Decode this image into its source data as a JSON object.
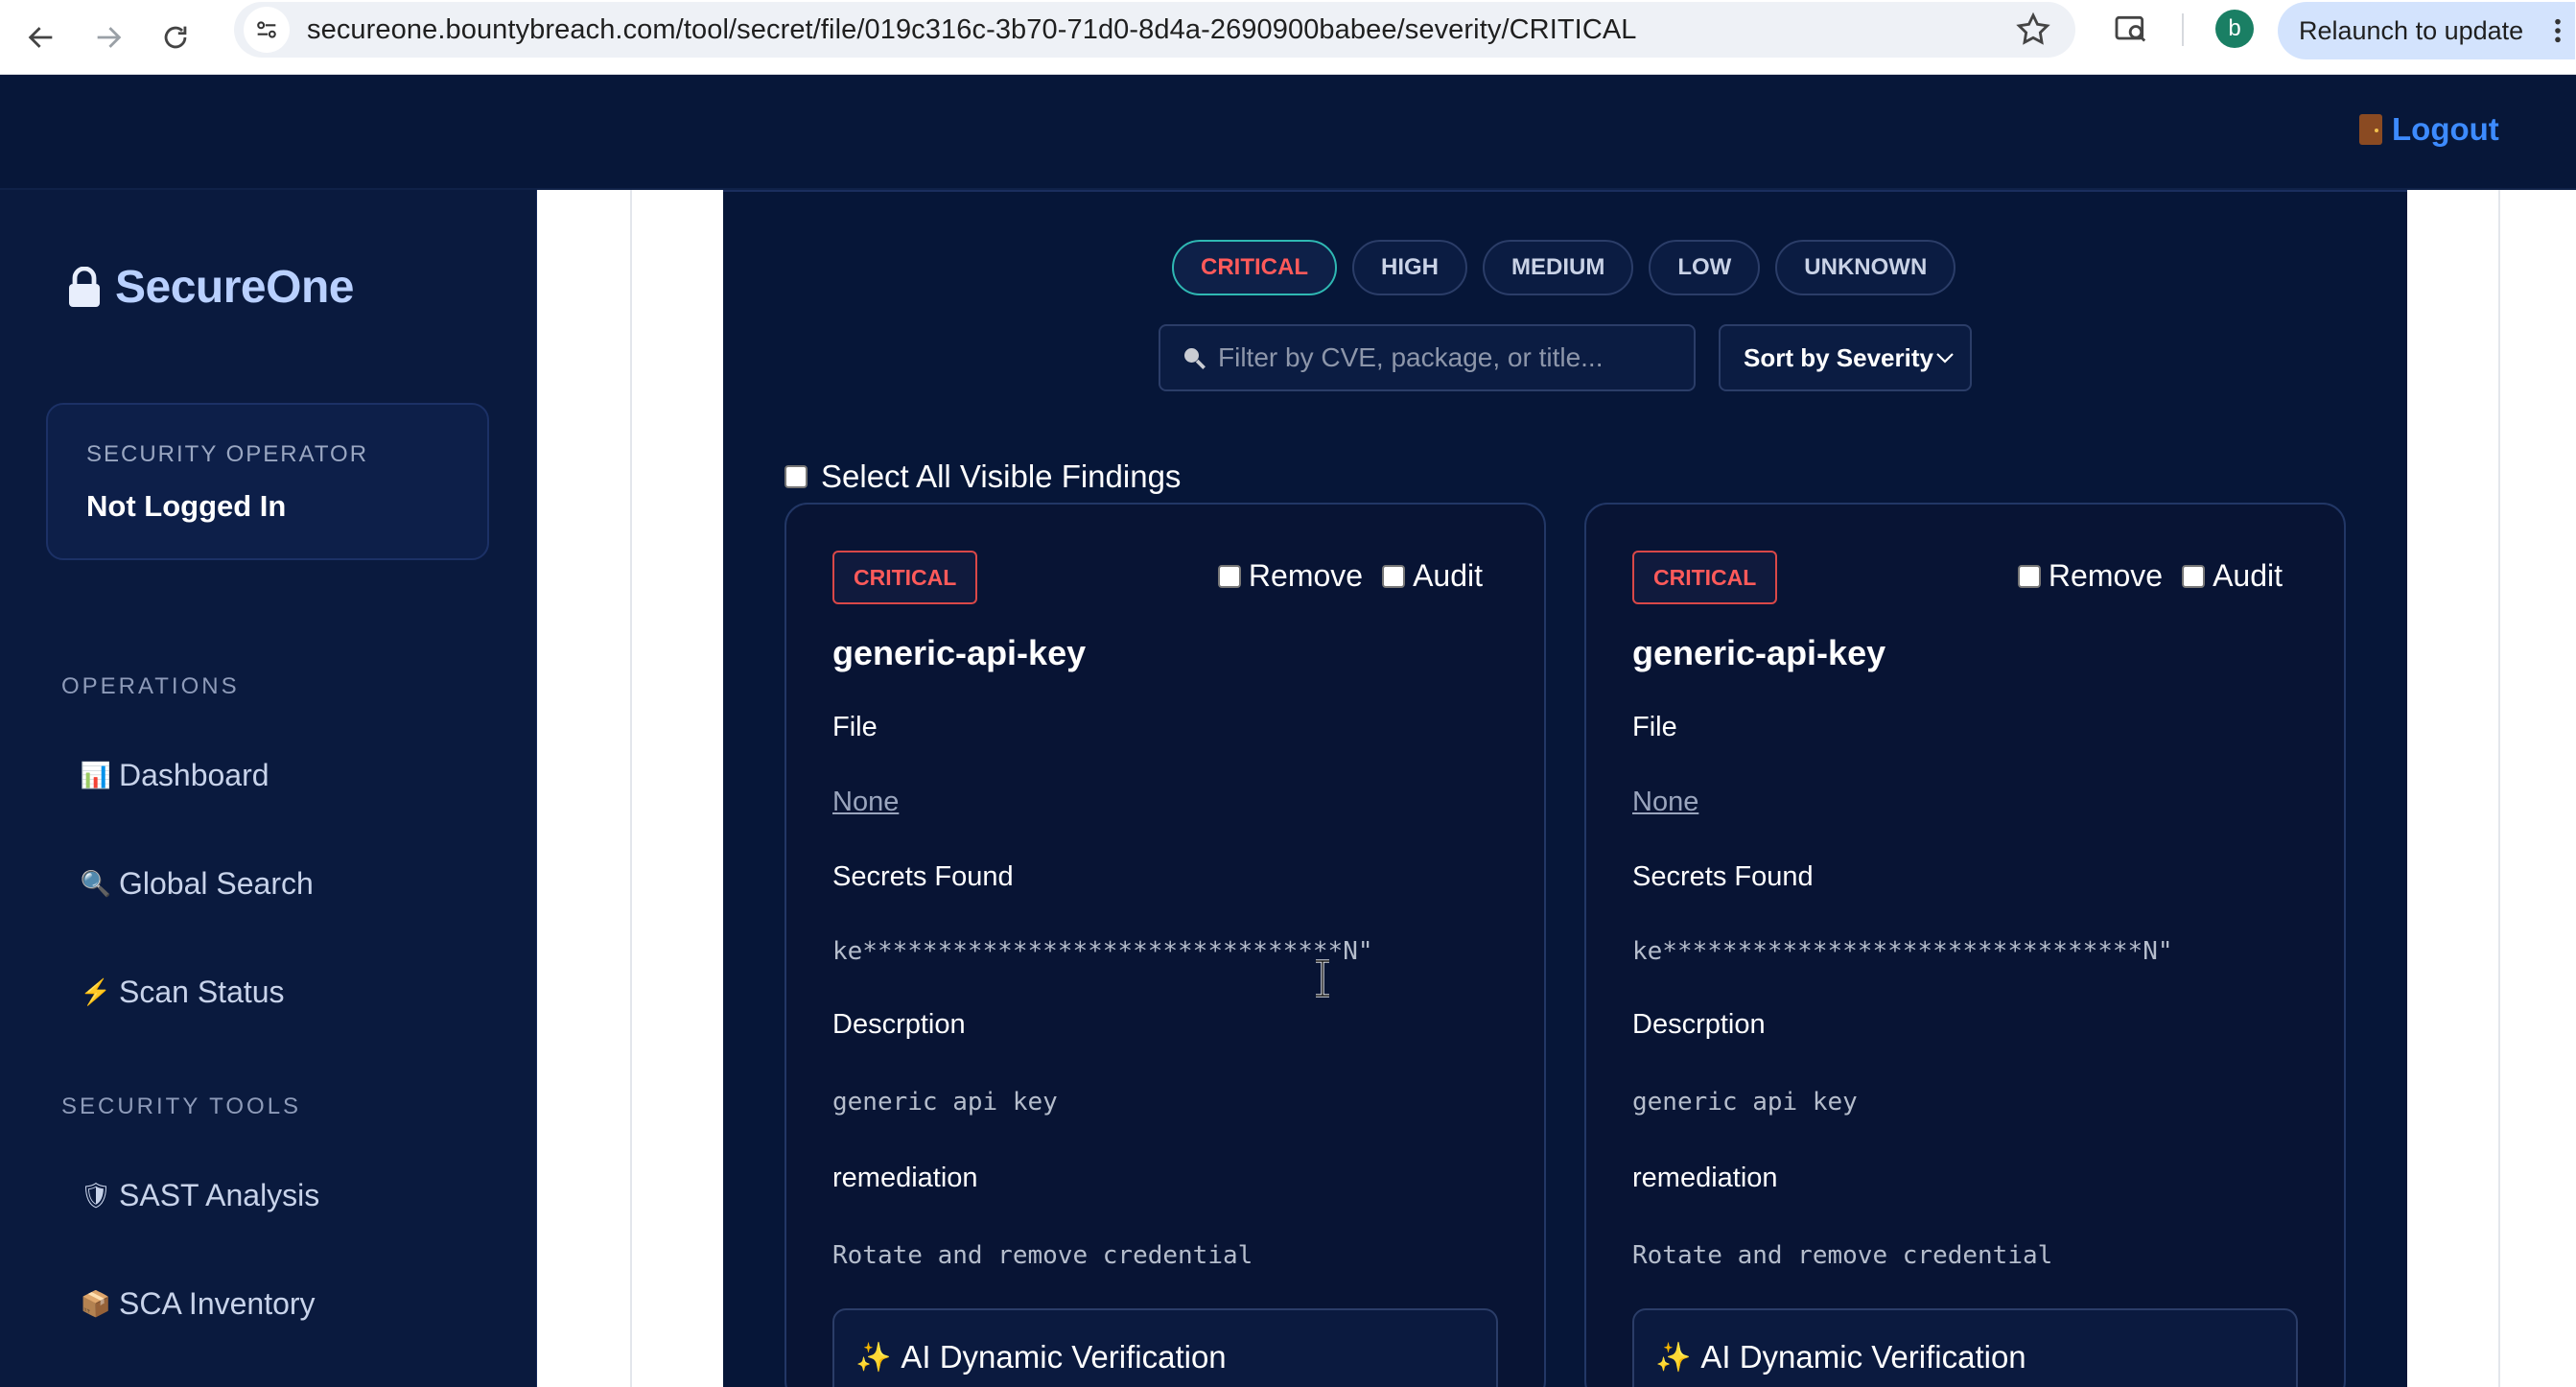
{
  "browser": {
    "url": "secureone.bountybreach.com/tool/secret/file/019c316c-3b70-71d0-8d4a-2690900babee/severity/CRITICAL",
    "profile_initial": "b",
    "relaunch_label": "Relaunch to update"
  },
  "topbar": {
    "logout_label": "Logout"
  },
  "sidebar": {
    "brand": "SecureOne",
    "operator_role": "SECURITY OPERATOR",
    "operator_status": "Not Logged In",
    "sections": [
      {
        "label": "OPERATIONS",
        "items": [
          {
            "icon": "📊",
            "label": "Dashboard"
          },
          {
            "icon": "🔍",
            "label": "Global Search"
          },
          {
            "icon": "⚡",
            "label": "Scan Status"
          }
        ]
      },
      {
        "label": "SECURITY TOOLS",
        "items": [
          {
            "icon": "🛡",
            "label": "SAST Analysis"
          },
          {
            "icon": "📦",
            "label": "SCA Inventory"
          }
        ]
      }
    ]
  },
  "filters": {
    "severity_tabs": [
      "CRITICAL",
      "HIGH",
      "MEDIUM",
      "LOW",
      "UNKNOWN"
    ],
    "active_tab": "CRITICAL",
    "search_placeholder": "Filter by CVE, package, or title...",
    "sort_label": "Sort by Severity"
  },
  "select_all_label": "Select All Visible Findings",
  "findings": [
    {
      "severity": "CRITICAL",
      "remove_label": "Remove",
      "audit_label": "Audit",
      "title": "generic-api-key",
      "file_label": "File",
      "file_value": "None",
      "secrets_label": "Secrets Found",
      "secret_value": "ke********************************N\"",
      "description_label": "Descrption",
      "description_value": "generic api key",
      "remediation_label": "remediation",
      "remediation_value": "Rotate and remove credential",
      "ai_label": "AI Dynamic Verification"
    },
    {
      "severity": "CRITICAL",
      "remove_label": "Remove",
      "audit_label": "Audit",
      "title": "generic-api-key",
      "file_label": "File",
      "file_value": "None",
      "secrets_label": "Secrets Found",
      "secret_value": "ke********************************N\"",
      "description_label": "Descrption",
      "description_value": "generic api key",
      "remediation_label": "remediation",
      "remediation_value": "Rotate and remove credential",
      "ai_label": "AI Dynamic Verification"
    }
  ],
  "colors": {
    "background": "#061638",
    "sidebar": "#0a1a3e",
    "accent_blue": "#3d8bff",
    "critical_red": "#ff5a5a",
    "active_tab_border": "#2fb8b3"
  }
}
